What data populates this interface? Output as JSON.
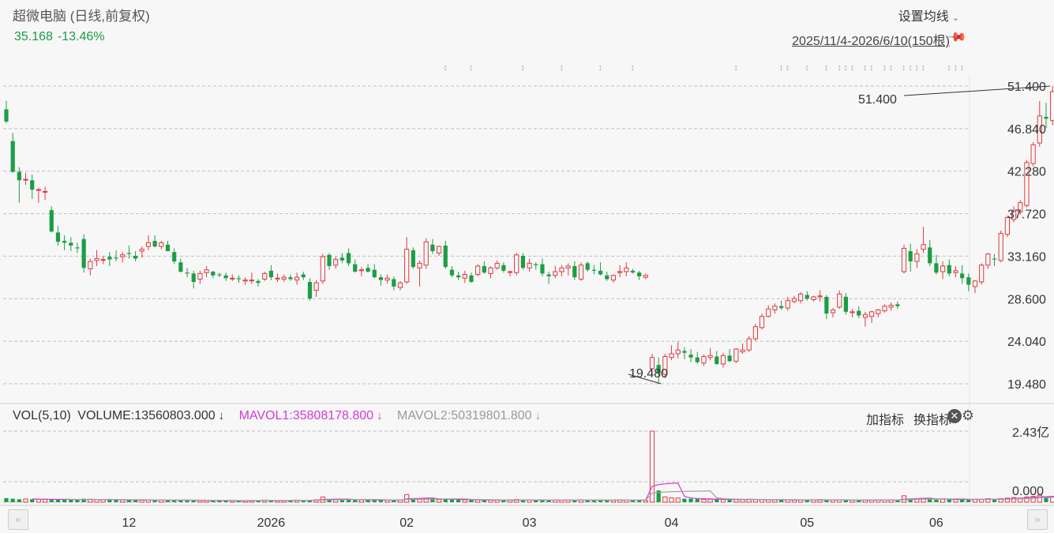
{
  "header": {
    "title": "超微电脑 (日线,前复权)",
    "price": "35.168",
    "change_pct": "-13.46%",
    "ma_settings_label": "设置均线",
    "date_range": "2025/11/4-2026/6/10(150根)"
  },
  "volume_panel": {
    "label": "VOL(5,10)",
    "volume": "VOLUME:13560803.000",
    "mavol1": "MAVOL1:35808178.800",
    "mavol2": "MAVOL2:50319801.800",
    "arrow": "↓",
    "add_indicator": "加指标",
    "switch_indicator": "换指标",
    "y_max_label": "2.43亿",
    "y_min_label": "0.000"
  },
  "annotations": {
    "high": "51.400",
    "low": "19.480"
  },
  "colors": {
    "up": "#e0393e",
    "down": "#1b9e44",
    "mavol1": "#d43ad4",
    "mavol2": "#a0a0a0"
  },
  "chart_data": {
    "type": "candlestick",
    "title": "超微电脑 (日线,前复权)",
    "ylim": [
      19.48,
      51.4
    ],
    "y_ticks": [
      "51.400",
      "46.840",
      "42.280",
      "37.720",
      "33.160",
      "28.600",
      "24.040",
      "19.480"
    ],
    "x_ticks": [
      {
        "label": "12",
        "index": 19
      },
      {
        "label": "2026",
        "index": 41
      },
      {
        "label": "02",
        "index": 62
      },
      {
        "label": "03",
        "index": 81
      },
      {
        "label": "04",
        "index": 103
      },
      {
        "label": "05",
        "index": 124
      },
      {
        "label": "06",
        "index": 144
      }
    ],
    "ohlc": [
      [
        48.9,
        49.8,
        47.4,
        47.6
      ],
      [
        45.5,
        46.4,
        42.1,
        42.2
      ],
      [
        42.2,
        42.7,
        38.9,
        41.3
      ],
      [
        41.4,
        42.1,
        40.8,
        41.4
      ],
      [
        41.3,
        41.9,
        39.3,
        40.3
      ],
      [
        40.3,
        40.5,
        38.9,
        40.3
      ],
      [
        40.1,
        40.6,
        39.2,
        40.1
      ],
      [
        38.1,
        38.5,
        35.7,
        35.8
      ],
      [
        35.7,
        36.4,
        34.3,
        34.7
      ],
      [
        34.8,
        35.4,
        33.8,
        34.6
      ],
      [
        34.6,
        35.2,
        33.7,
        34.3
      ],
      [
        34.1,
        34.6,
        33.5,
        34.0
      ],
      [
        35.0,
        35.5,
        31.4,
        31.9
      ],
      [
        31.8,
        32.9,
        31.1,
        32.6
      ],
      [
        32.7,
        33.8,
        32.1,
        32.9
      ],
      [
        32.8,
        33.2,
        32.3,
        32.8
      ],
      [
        33.1,
        33.6,
        32.1,
        32.8
      ],
      [
        33.0,
        33.8,
        32.6,
        32.9
      ],
      [
        33.1,
        33.6,
        32.5,
        33.3
      ],
      [
        33.5,
        34.3,
        32.9,
        33.4
      ],
      [
        33.2,
        33.7,
        32.6,
        32.9
      ],
      [
        33.7,
        34.2,
        33.0,
        33.9
      ],
      [
        34.2,
        35.4,
        33.8,
        34.6
      ],
      [
        34.8,
        35.4,
        34.1,
        34.2
      ],
      [
        34.2,
        34.8,
        33.9,
        34.6
      ],
      [
        34.4,
        34.8,
        33.7,
        33.7
      ],
      [
        33.6,
        34.0,
        32.3,
        32.6
      ],
      [
        32.5,
        32.9,
        31.4,
        31.5
      ],
      [
        31.4,
        31.9,
        30.9,
        31.3
      ],
      [
        31.3,
        31.6,
        29.7,
        30.4
      ],
      [
        30.7,
        31.6,
        30.2,
        31.3
      ],
      [
        31.4,
        32.1,
        30.9,
        31.7
      ],
      [
        31.5,
        31.6,
        30.8,
        31.1
      ],
      [
        31.2,
        31.4,
        30.9,
        31.1
      ],
      [
        31.1,
        31.4,
        30.5,
        30.8
      ],
      [
        30.8,
        31.2,
        30.5,
        30.8
      ],
      [
        30.8,
        31.1,
        30.3,
        30.7
      ],
      [
        30.5,
        30.9,
        30.1,
        30.6
      ],
      [
        30.6,
        31.4,
        30.2,
        30.6
      ],
      [
        30.5,
        30.7,
        29.9,
        30.3
      ],
      [
        30.7,
        31.5,
        30.5,
        31.3
      ],
      [
        31.6,
        32.2,
        30.6,
        30.9
      ],
      [
        30.8,
        31.3,
        30.4,
        30.8
      ],
      [
        30.7,
        31.2,
        30.4,
        30.9
      ],
      [
        30.9,
        31.2,
        30.5,
        30.7
      ],
      [
        30.6,
        31.4,
        30.1,
        30.9
      ],
      [
        31.2,
        31.5,
        30.6,
        30.9
      ],
      [
        30.4,
        30.8,
        28.4,
        28.6
      ],
      [
        29.5,
        30.6,
        28.8,
        30.3
      ],
      [
        30.5,
        33.4,
        30.2,
        33.1
      ],
      [
        33.3,
        33.5,
        31.7,
        32.1
      ],
      [
        32.2,
        33.1,
        31.8,
        32.8
      ],
      [
        33.0,
        33.5,
        32.4,
        32.7
      ],
      [
        33.5,
        34.0,
        32.1,
        32.4
      ],
      [
        32.3,
        32.8,
        31.4,
        31.5
      ],
      [
        31.6,
        32.0,
        31.0,
        31.7
      ],
      [
        31.9,
        32.3,
        31.4,
        31.5
      ],
      [
        31.7,
        32.3,
        30.8,
        30.9
      ],
      [
        30.9,
        31.2,
        30.0,
        30.6
      ],
      [
        30.6,
        31.2,
        30.2,
        30.8
      ],
      [
        30.7,
        31.0,
        29.5,
        29.9
      ],
      [
        29.8,
        30.5,
        29.5,
        30.3
      ],
      [
        30.4,
        35.2,
        30.2,
        33.9
      ],
      [
        33.8,
        34.1,
        31.8,
        32.0
      ],
      [
        31.9,
        32.7,
        29.9,
        32.4
      ],
      [
        32.2,
        35.1,
        31.8,
        34.7
      ],
      [
        34.4,
        35.0,
        33.4,
        33.7
      ],
      [
        33.5,
        34.3,
        33.2,
        34.2
      ],
      [
        34.3,
        34.8,
        31.8,
        32.0
      ],
      [
        31.7,
        32.1,
        30.9,
        31.1
      ],
      [
        31.1,
        31.5,
        30.6,
        30.9
      ],
      [
        30.8,
        31.6,
        30.3,
        31.2
      ],
      [
        31.1,
        31.4,
        30.3,
        30.4
      ],
      [
        31.2,
        32.3,
        31.0,
        32.1
      ],
      [
        32.1,
        32.6,
        31.3,
        31.4
      ],
      [
        31.3,
        32.1,
        30.8,
        31.9
      ],
      [
        31.9,
        32.7,
        31.7,
        32.4
      ],
      [
        32.2,
        32.5,
        31.4,
        31.6
      ],
      [
        31.5,
        31.6,
        31.0,
        31.5
      ],
      [
        31.4,
        33.5,
        31.1,
        33.3
      ],
      [
        33.2,
        33.5,
        31.7,
        31.9
      ],
      [
        31.9,
        32.9,
        31.5,
        32.4
      ],
      [
        32.3,
        32.5,
        31.7,
        32.2
      ],
      [
        32.3,
        32.9,
        31.0,
        31.3
      ],
      [
        31.2,
        31.5,
        30.2,
        31.0
      ],
      [
        31.1,
        32.1,
        30.8,
        31.5
      ],
      [
        31.5,
        32.2,
        31.0,
        31.9
      ],
      [
        31.9,
        32.4,
        31.1,
        32.1
      ],
      [
        32.1,
        32.6,
        30.6,
        30.9
      ],
      [
        30.7,
        32.5,
        30.5,
        32.2
      ],
      [
        32.4,
        32.6,
        31.5,
        31.7
      ],
      [
        31.7,
        32.2,
        31.2,
        31.6
      ],
      [
        31.6,
        32.5,
        31.1,
        31.2
      ],
      [
        31.1,
        31.5,
        30.5,
        30.7
      ],
      [
        30.6,
        31.2,
        30.3,
        31.1
      ],
      [
        31.5,
        32.2,
        30.9,
        31.5
      ],
      [
        31.5,
        32.5,
        31.0,
        31.9
      ],
      [
        31.6,
        31.8,
        31.3,
        31.4
      ],
      [
        31.4,
        31.6,
        30.6,
        31.0
      ],
      [
        30.9,
        31.3,
        30.7,
        31.1
      ],
      [
        21.1,
        22.7,
        20.5,
        22.3
      ],
      [
        21.5,
        22.3,
        19.48,
        20.6
      ],
      [
        20.5,
        22.7,
        20.1,
        22.4
      ],
      [
        22.3,
        23.6,
        22.0,
        22.7
      ],
      [
        22.7,
        24.0,
        22.2,
        23.1
      ],
      [
        23.0,
        23.4,
        22.1,
        22.8
      ],
      [
        22.6,
        23.2,
        21.8,
        22.3
      ],
      [
        22.3,
        22.9,
        21.6,
        21.8
      ],
      [
        21.7,
        22.6,
        21.4,
        22.4
      ],
      [
        22.3,
        23.3,
        22.0,
        22.5
      ],
      [
        22.4,
        23.0,
        21.5,
        21.6
      ],
      [
        21.6,
        22.8,
        21.2,
        22.5
      ],
      [
        22.5,
        23.2,
        21.8,
        21.9
      ],
      [
        21.9,
        23.3,
        21.7,
        23.2
      ],
      [
        22.9,
        23.8,
        22.7,
        23.1
      ],
      [
        23.1,
        24.6,
        22.9,
        24.3
      ],
      [
        24.3,
        25.9,
        24.1,
        25.6
      ],
      [
        25.5,
        27.0,
        25.3,
        26.7
      ],
      [
        26.7,
        27.9,
        26.6,
        27.5
      ],
      [
        27.4,
        28.1,
        27.0,
        27.8
      ],
      [
        27.8,
        28.4,
        27.4,
        27.6
      ],
      [
        27.6,
        28.8,
        27.3,
        28.4
      ],
      [
        28.3,
        28.9,
        28.1,
        28.6
      ],
      [
        28.4,
        29.3,
        28.1,
        29.1
      ],
      [
        29.0,
        29.4,
        28.4,
        28.6
      ],
      [
        28.5,
        28.9,
        28.3,
        28.8
      ],
      [
        28.8,
        29.5,
        28.3,
        28.9
      ],
      [
        28.8,
        29.0,
        26.4,
        27.0
      ],
      [
        27.1,
        27.6,
        26.6,
        27.4
      ],
      [
        27.7,
        29.5,
        27.5,
        29.1
      ],
      [
        28.8,
        29.2,
        26.9,
        27.2
      ],
      [
        27.1,
        27.5,
        26.6,
        27.2
      ],
      [
        27.3,
        27.8,
        26.5,
        26.8
      ],
      [
        26.6,
        27.2,
        25.6,
        26.9
      ],
      [
        26.7,
        27.3,
        26.0,
        27.2
      ],
      [
        27.0,
        27.5,
        26.6,
        27.4
      ],
      [
        27.3,
        28.0,
        27.1,
        27.8
      ],
      [
        27.7,
        28.2,
        27.3,
        27.9
      ],
      [
        28.0,
        28.3,
        27.5,
        27.8
      ],
      [
        31.5,
        34.4,
        31.3,
        34.0
      ],
      [
        33.7,
        34.5,
        31.5,
        32.6
      ],
      [
        32.6,
        33.9,
        31.9,
        33.4
      ],
      [
        33.9,
        36.3,
        33.5,
        34.4
      ],
      [
        34.1,
        34.9,
        32.1,
        32.4
      ],
      [
        32.4,
        33.3,
        31.2,
        31.4
      ],
      [
        31.5,
        32.6,
        30.7,
        32.1
      ],
      [
        32.2,
        32.8,
        31.0,
        31.3
      ],
      [
        31.4,
        32.1,
        30.9,
        31.6
      ],
      [
        31.3,
        32.2,
        30.2,
        30.8
      ],
      [
        30.9,
        31.3,
        29.4,
        30.1
      ],
      [
        29.9,
        30.6,
        29.2,
        30.5
      ],
      [
        30.4,
        32.4,
        30.1,
        32.2
      ],
      [
        32.2,
        33.5,
        31.8,
        33.4
      ],
      [
        32.9,
        33.4,
        32.1,
        32.8
      ],
      [
        32.7,
        35.9,
        32.5,
        35.6
      ],
      [
        35.5,
        37.5,
        35.2,
        37.3
      ],
      [
        37.1,
        38.5,
        36.8,
        38.0
      ],
      [
        37.9,
        39.2,
        37.6,
        38.9
      ],
      [
        38.6,
        43.5,
        38.4,
        43.2
      ],
      [
        43.1,
        45.4,
        42.8,
        45.1
      ],
      [
        45.3,
        49.8,
        44.9,
        48.2
      ],
      [
        48.1,
        49.6,
        46.9,
        47.9
      ],
      [
        47.7,
        51.4,
        47.2,
        50.8
      ],
      [
        50.5,
        51.0,
        48.9,
        49.5
      ],
      [
        49.1,
        49.4,
        47.7,
        48.4
      ],
      [
        48.3,
        48.8,
        46.1,
        46.6
      ],
      [
        46.5,
        47.1,
        45.6,
        46.8
      ],
      [
        45.4,
        45.7,
        42.8,
        43.1
      ],
      [
        43.1,
        44.3,
        40.9,
        41.4
      ],
      [
        44.1,
        44.5,
        37.9,
        40.4
      ],
      [
        35.8,
        36.5,
        34.4,
        35.168
      ]
    ],
    "volume": [
      0.14,
      0.12,
      0.1,
      0.11,
      0.1,
      0.1,
      0.1,
      0.08,
      0.09,
      0.1,
      0.08,
      0.07,
      0.12,
      0.1,
      0.09,
      0.08,
      0.08,
      0.08,
      0.08,
      0.07,
      0.07,
      0.07,
      0.08,
      0.07,
      0.07,
      0.07,
      0.08,
      0.07,
      0.06,
      0.06,
      0.06,
      0.06,
      0.06,
      0.05,
      0.05,
      0.05,
      0.05,
      0.05,
      0.06,
      0.06,
      0.07,
      0.06,
      0.05,
      0.05,
      0.06,
      0.07,
      0.05,
      0.08,
      0.08,
      0.18,
      0.1,
      0.08,
      0.08,
      0.09,
      0.08,
      0.08,
      0.07,
      0.07,
      0.07,
      0.07,
      0.07,
      0.08,
      0.26,
      0.13,
      0.11,
      0.12,
      0.11,
      0.09,
      0.1,
      0.09,
      0.08,
      0.08,
      0.07,
      0.08,
      0.07,
      0.07,
      0.07,
      0.07,
      0.07,
      0.09,
      0.08,
      0.07,
      0.07,
      0.08,
      0.07,
      0.07,
      0.07,
      0.07,
      0.07,
      0.08,
      0.07,
      0.07,
      0.07,
      0.06,
      0.07,
      0.08,
      0.07,
      0.07,
      0.07,
      0.06,
      2.43,
      0.4,
      0.18,
      0.15,
      0.14,
      0.12,
      0.12,
      0.11,
      0.1,
      0.1,
      0.1,
      0.09,
      0.09,
      0.09,
      0.09,
      0.1,
      0.09,
      0.09,
      0.08,
      0.08,
      0.08,
      0.08,
      0.07,
      0.08,
      0.07,
      0.08,
      0.09,
      0.08,
      0.07,
      0.08,
      0.08,
      0.07,
      0.07,
      0.07,
      0.07,
      0.07,
      0.07,
      0.08,
      0.07,
      0.22,
      0.12,
      0.12,
      0.13,
      0.11,
      0.09,
      0.1,
      0.09,
      0.09,
      0.09,
      0.09,
      0.1,
      0.1,
      0.12,
      0.1,
      0.12,
      0.14,
      0.16,
      0.14,
      0.18,
      0.2,
      0.24,
      0.18,
      0.2,
      0.16,
      0.14,
      0.14,
      0.12,
      0.13,
      0.14,
      0.16,
      0.14
    ],
    "series": [
      {
        "name": "MAVOL1",
        "type": "line"
      },
      {
        "name": "MAVOL2",
        "type": "line"
      }
    ],
    "vol_ylim": [
      0,
      2.43
    ]
  }
}
